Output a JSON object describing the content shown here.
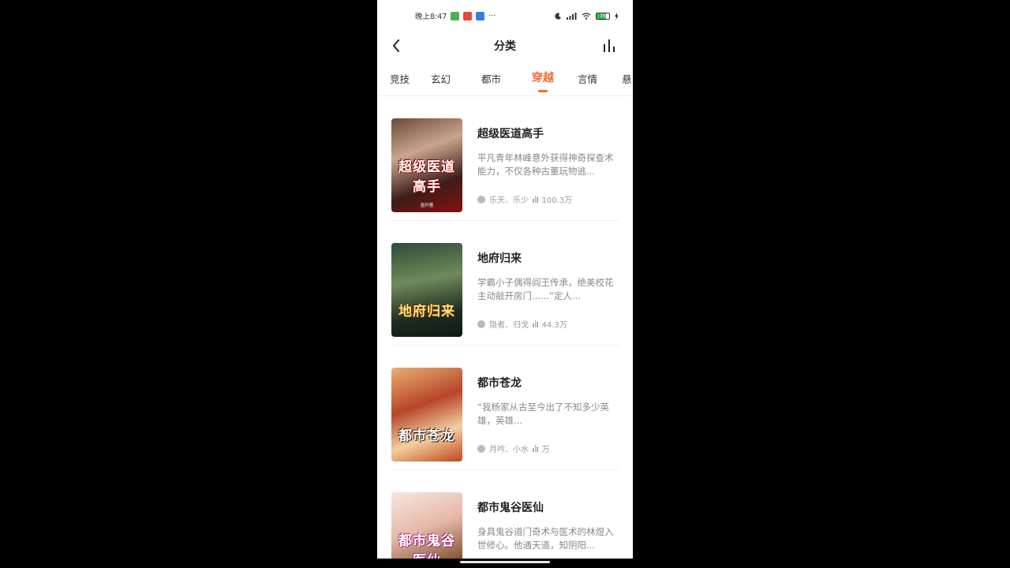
{
  "status_bar": {
    "time": "晚上8:47",
    "dots": "···",
    "battery": "76"
  },
  "header": {
    "title": "分类"
  },
  "tabs": [
    {
      "label": "竞技"
    },
    {
      "label": "玄幻"
    },
    {
      "label": "都市"
    },
    {
      "label": "穿越",
      "active": true
    },
    {
      "label": "言情"
    },
    {
      "label": "悬"
    }
  ],
  "books": [
    {
      "title": "超级医道高手",
      "description": "平凡青年林峰意外获得神奇探查术能力，不仅各种古董玩物逃...",
      "authors": "乐天、乐少",
      "popularity": "100.3万",
      "cover_title": "超级医道高手",
      "cover_author": "墨轩著"
    },
    {
      "title": "地府归来",
      "description": "学霸小子偶得阎王传承，绝美校花主动敲开房门......“定人...",
      "authors": "隐者、归戈",
      "popularity": "44.3万",
      "cover_title": "地府归来",
      "cover_author": ""
    },
    {
      "title": "都市苍龙",
      "description": "“我杨家从古至今出了不知多少英雄，英雄...",
      "authors": "月吟、小水",
      "popularity": "万",
      "cover_title": "都市苍龙",
      "cover_author": ""
    },
    {
      "title": "都市鬼谷医仙",
      "description": "身具鬼谷道门奇术与医术的林煜入世修心。他通天道，知阴阳...",
      "authors": "",
      "popularity": "",
      "cover_title": "都市鬼谷医仙",
      "cover_author": ""
    }
  ]
}
